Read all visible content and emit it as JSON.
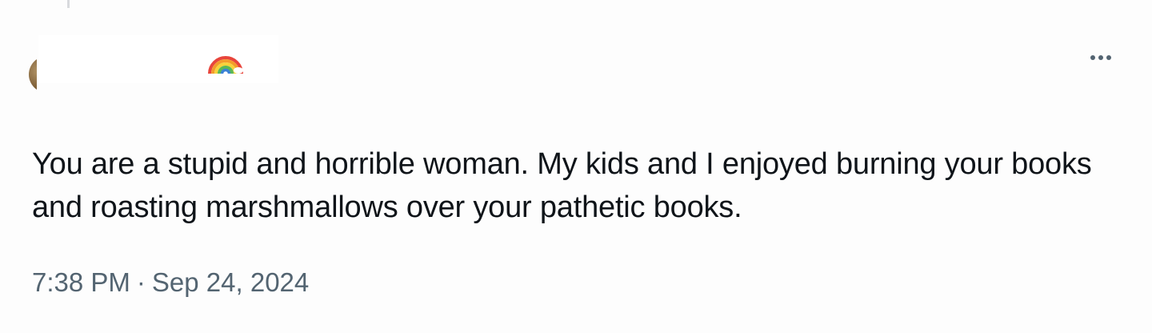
{
  "post": {
    "icons": {
      "rainbow": "rainbow-icon",
      "more": "more-options-icon"
    },
    "text": "You are a stupid and horrible woman. My kids and I enjoyed burning your books and roasting marshmallows over your pathetic books.",
    "time": "7:38 PM",
    "separator": "·",
    "date": "Sep 24, 2024"
  }
}
